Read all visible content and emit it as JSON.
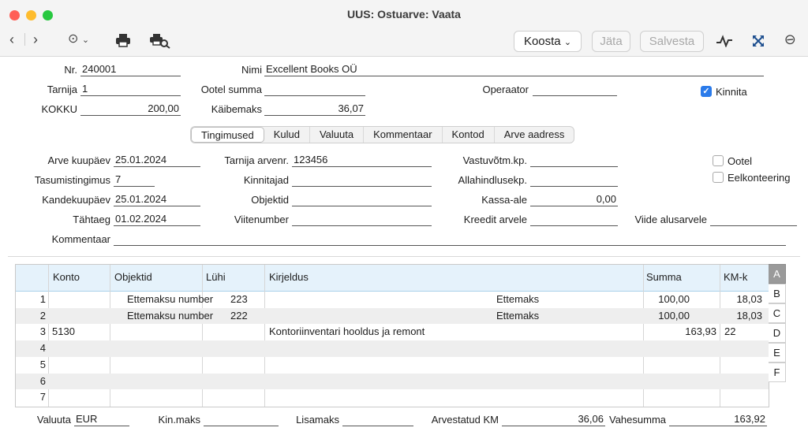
{
  "window": {
    "title": "UUS: Ostuarve: Vaata"
  },
  "toolbar": {
    "back_icon": "chevron-left-icon",
    "forward_icon": "chevron-right-icon",
    "koosta_label": "Koosta",
    "jata_label": "Jäta",
    "salvesta_label": "Salvesta"
  },
  "header": {
    "nr_label": "Nr.",
    "nr_value": "240001",
    "nimi_label": "Nimi",
    "nimi_value": "Excellent Books OÜ",
    "tarnija_label": "Tarnija",
    "tarnija_value": "1",
    "ootel_summa_label": "Ootel summa",
    "ootel_summa_value": "",
    "operaator_label": "Operaator",
    "operaator_value": "",
    "kinnita_label": "Kinnita",
    "kokku_label": "KOKKU",
    "kokku_value": "200,00",
    "kaibemaks_label": "Käibemaks",
    "kaibemaks_value": "36,07"
  },
  "tabs": [
    "Tingimused",
    "Kulud",
    "Valuuta",
    "Kommentaar",
    "Kontod",
    "Arve aadress"
  ],
  "terms": {
    "arve_kuupaev_label": "Arve kuupäev",
    "arve_kuupaev_value": "25.01.2024",
    "tarnija_arvenr_label": "Tarnija arvenr.",
    "tarnija_arvenr_value": "123456",
    "vastuvotm_label": "Vastuvõtm.kp.",
    "vastuvotm_value": "",
    "ootel_label": "Ootel",
    "tasumistingimus_label": "Tasumistingimus",
    "tasumistingimus_value": "7",
    "kinnitajad_label": "Kinnitajad",
    "kinnitajad_value": "",
    "allahindlusekp_label": "Allahindlusekp.",
    "allahindlusekp_value": "",
    "eelkonteering_label": "Eelkonteering",
    "kandekuupaev_label": "Kandekuupäev",
    "kandekuupaev_value": "25.01.2024",
    "objektid_label": "Objektid",
    "objektid_value": "",
    "kassa_ale_label": "Kassa-ale",
    "kassa_ale_value": "0,00",
    "tahtaeg_label": "Tähtaeg",
    "tahtaeg_value": "01.02.2024",
    "viitenumber_label": "Viitenumber",
    "viitenumber_value": "",
    "kreedit_arvele_label": "Kreedit arvele",
    "kreedit_arvele_value": "",
    "viide_alusarvele_label": "Viide alusarvele",
    "viide_alusarvele_value": "",
    "kommentaar_label": "Kommentaar",
    "kommentaar_value": ""
  },
  "grid": {
    "columns": [
      "Konto",
      "Objektid",
      "Lühi",
      "Kirjeldus",
      "Summa",
      "KM-k"
    ],
    "rows": [
      {
        "n": "1",
        "konto": "",
        "objektid": "Ettemaksu number",
        "luhi": "223",
        "kirjeldus": "",
        "extra": "Ettemaks",
        "summa": "100,00",
        "kmk": "18,03"
      },
      {
        "n": "2",
        "konto": "",
        "objektid": "Ettemaksu number",
        "luhi": "222",
        "kirjeldus": "",
        "extra": "Ettemaks",
        "summa": "100,00",
        "kmk": "18,03"
      },
      {
        "n": "3",
        "konto": "5130",
        "objektid": "",
        "luhi": "",
        "kirjeldus": "Kontoriinventari hooldus ja remont",
        "extra": "",
        "summa": "163,93",
        "kmk": "22"
      },
      {
        "n": "4",
        "konto": "",
        "objektid": "",
        "luhi": "",
        "kirjeldus": "",
        "extra": "",
        "summa": "",
        "kmk": ""
      },
      {
        "n": "5",
        "konto": "",
        "objektid": "",
        "luhi": "",
        "kirjeldus": "",
        "extra": "",
        "summa": "",
        "kmk": ""
      },
      {
        "n": "6",
        "konto": "",
        "objektid": "",
        "luhi": "",
        "kirjeldus": "",
        "extra": "",
        "summa": "",
        "kmk": ""
      },
      {
        "n": "7",
        "konto": "",
        "objektid": "",
        "luhi": "",
        "kirjeldus": "",
        "extra": "",
        "summa": "",
        "kmk": ""
      }
    ],
    "side_tabs": [
      "A",
      "B",
      "C",
      "D",
      "E",
      "F"
    ]
  },
  "footer": {
    "valuuta_label": "Valuuta",
    "valuuta_value": "EUR",
    "kinmaks_label": "Kin.maks",
    "kinmaks_value": "",
    "lisamaks_label": "Lisamaks",
    "lisamaks_value": "",
    "arvestatud_km_label": "Arvestatud KM",
    "arvestatud_km_value": "36,06",
    "vahesumma_label": "Vahesumma",
    "vahesumma_value": "163,92"
  },
  "colors": {
    "accent": "#2b7bea",
    "grid_header": "#e5f2fb",
    "close": "#ff5f57",
    "minimize": "#febc2e",
    "zoom": "#28c840"
  }
}
